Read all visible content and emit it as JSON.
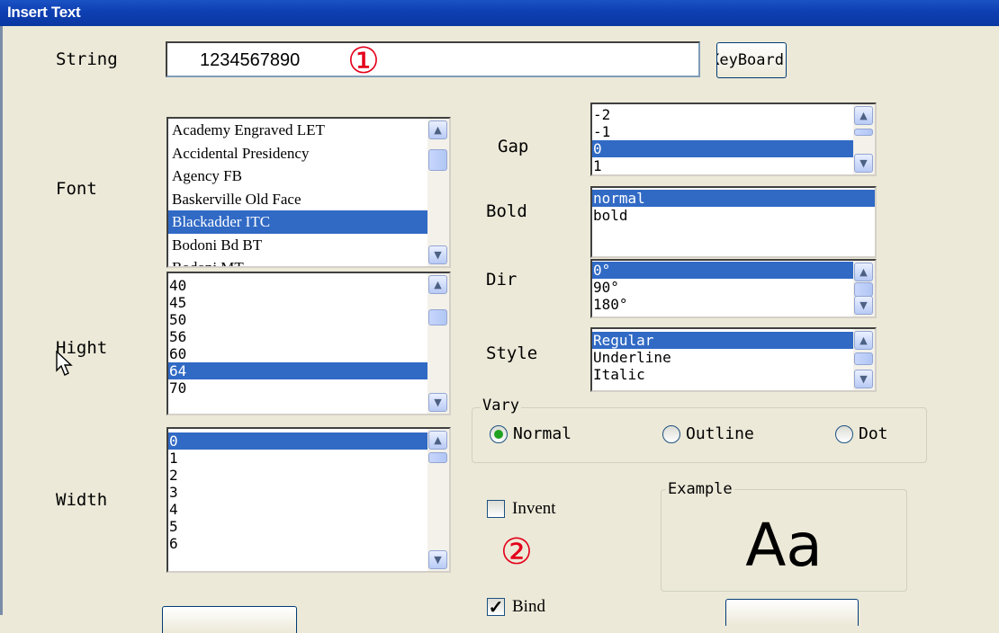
{
  "window": {
    "title": "Insert Text"
  },
  "string": {
    "label": "String",
    "value": "1234567890",
    "keyboard_label": "KeyBoard"
  },
  "markers": {
    "one": "①",
    "two": "②"
  },
  "font": {
    "label": "Font",
    "items": [
      "Academy Engraved LET",
      "Accidental Presidency",
      "Agency FB",
      "Baskerville Old Face",
      "Blackadder ITC",
      "Bodoni Bd BT",
      "Bodoni MT"
    ],
    "selected": "Blackadder ITC"
  },
  "height": {
    "label": "Hight",
    "items": [
      "40",
      "45",
      "50",
      "56",
      "60",
      "64",
      "70"
    ],
    "selected": "64"
  },
  "width": {
    "label": "Width",
    "items": [
      "0",
      "1",
      "2",
      "3",
      "4",
      "5",
      "6"
    ],
    "selected": "0"
  },
  "gap": {
    "label": "Gap",
    "items": [
      "-2",
      "-1",
      "0",
      "1"
    ],
    "selected": "0"
  },
  "bold": {
    "label": "Bold",
    "items": [
      "normal",
      "bold"
    ],
    "selected": "normal"
  },
  "dir": {
    "label": "Dir",
    "items": [
      "0°",
      "90°",
      "180°"
    ],
    "selected": "0°"
  },
  "style": {
    "label": "Style",
    "items": [
      "Regular",
      "Underline",
      "Italic"
    ],
    "selected": "Regular"
  },
  "vary": {
    "title": "Vary",
    "options": [
      "Normal",
      "Outline",
      "Dot"
    ],
    "selected": "Normal"
  },
  "invent": {
    "label": "Invent",
    "checked": false
  },
  "bind": {
    "label": "Bind",
    "checked": true
  },
  "example": {
    "title": "Example",
    "sample": "Aa"
  },
  "colors": {
    "titlebar": "#0a37a2",
    "selection": "#316ac5",
    "marker": "#e4001b",
    "radio_dot": "#21a121"
  }
}
